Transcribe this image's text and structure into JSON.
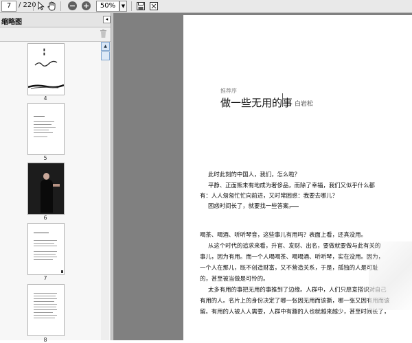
{
  "toolbar": {
    "page_current": "7",
    "page_total": "/ 220",
    "zoom": "50%",
    "icons": [
      "select-arrow-icon",
      "hand-icon",
      "zoom-out-icon",
      "zoom-in-icon",
      "save-icon",
      "fit-page-icon"
    ]
  },
  "panel": {
    "title": "缩略图",
    "thumbnails": [
      {
        "number": "4"
      },
      {
        "number": "5"
      },
      {
        "number": "6"
      },
      {
        "number": "7"
      },
      {
        "number": "8"
      }
    ]
  },
  "page": {
    "label": "推荐序",
    "title": "做一些无用的事",
    "author": "白岩松",
    "lines": [
      "此时此刻的中国人，我们，怎么啦？",
      "平静、正面熊未有地成为奢侈品，而除了幸福，我们又似乎什么都",
      "有：人人匆匆忙忙向前进，又时常困惑：我要去哪儿？",
      "困惑时间长了，就要找一些答案。",
      "喝茶、喝酒、听听琴音，这些事儿有用吗？表面上看，还真没用。",
      "从这个时代的追求来看，升官、发财、出名，要做就要做与此有关的",
      "事儿，因为有用。而一个人喝喝茶、喝喝酒、听听琴，实在没用。因为，",
      "一个人在那儿，既不创造财富，又不营造关系，于是，孤独的人是可耻",
      "的，甚至被当做是可怜的。",
      "太多有用的事把无用的事推到了边缘。人群中，人们只愿意搭识对自己",
      "有用的人。名片上的身份决定了哪一张因无用而该撕，哪一张又因有用而该",
      "留。有用的人被人人需要，人群中有趣的人也就越来越少，甚至时间长了，"
    ]
  }
}
